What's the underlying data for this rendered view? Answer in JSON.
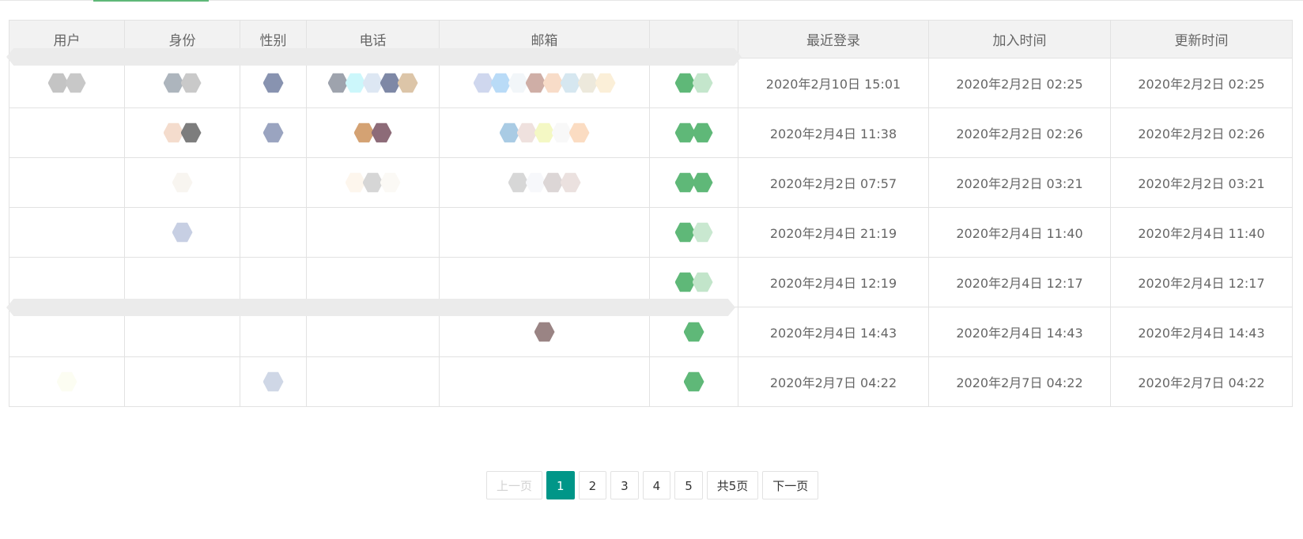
{
  "table": {
    "headers": [
      "用户",
      "身份",
      "性别",
      "电话",
      "邮箱",
      "",
      "最近登录",
      "加入时间",
      "更新时间"
    ],
    "rows": [
      {
        "last_login": "2020年2月10日 15:01",
        "joined": "2020年2月2日 02:25",
        "updated": "2020年2月2日 02:25"
      },
      {
        "last_login": "2020年2月4日 11:38",
        "joined": "2020年2月2日 02:26",
        "updated": "2020年2月2日 02:26"
      },
      {
        "last_login": "2020年2月2日 07:57",
        "joined": "2020年2月2日 03:21",
        "updated": "2020年2月2日 03:21"
      },
      {
        "last_login": "2020年2月4日 21:19",
        "joined": "2020年2月4日 11:40",
        "updated": "2020年2月4日 11:40"
      },
      {
        "last_login": "2020年2月4日 12:19",
        "joined": "2020年2月4日 12:17",
        "updated": "2020年2月4日 12:17"
      },
      {
        "last_login": "2020年2月4日 14:43",
        "joined": "2020年2月4日 14:43",
        "updated": "2020年2月4日 14:43"
      },
      {
        "last_login": "2020年2月7日 04:22",
        "joined": "2020年2月7日 04:22",
        "updated": "2020年2月7日 04:22"
      }
    ]
  },
  "pagination": {
    "prev": "上一页",
    "pages": [
      "1",
      "2",
      "3",
      "4",
      "5"
    ],
    "current": "1",
    "total": "共5页",
    "next": "下一页"
  },
  "colors": {
    "accent": "#009688",
    "status_green": "#5fb878"
  }
}
